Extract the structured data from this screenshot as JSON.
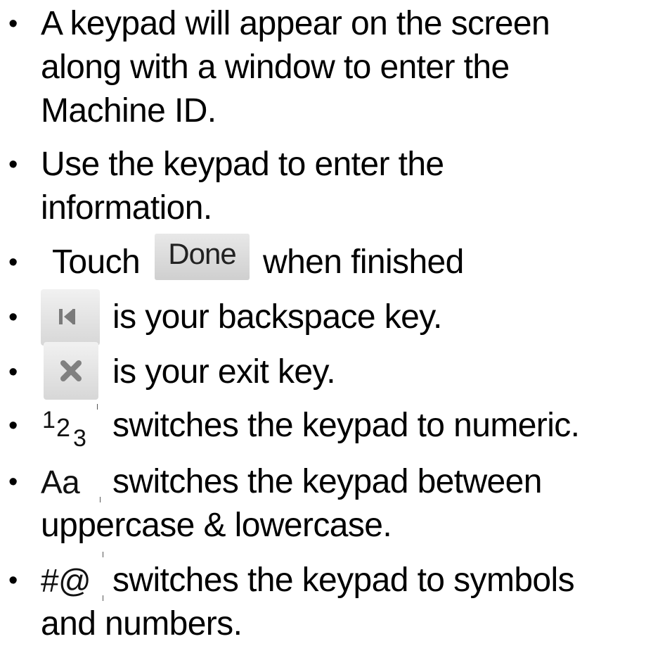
{
  "bullet_char": "•",
  "items": [
    {
      "lines": [
        "A keypad will appear on the screen",
        "along with a window to enter the",
        "Machine ID."
      ]
    },
    {
      "lines": [
        "Use the keypad to enter the",
        "information."
      ]
    },
    {
      "prefix": "Touch",
      "key_label": "Done",
      "suffix": "when finished"
    },
    {
      "key_icon": "backspace-key-icon",
      "suffix": "is your backspace key."
    },
    {
      "key_icon": "exit-key-icon",
      "suffix": "is your exit key."
    },
    {
      "key_label_parts": [
        "1",
        "2",
        "3"
      ],
      "suffix": "switches the keypad to numeric."
    },
    {
      "key_label": "Aa",
      "suffix": "switches the keypad between",
      "continuation": "uppercase & lowercase."
    },
    {
      "key_label": "#@",
      "suffix": "switches the keypad to symbols",
      "continuation": "and numbers."
    }
  ],
  "colors": {
    "text": "#000000",
    "key_background": "#d9d9d9",
    "key_icon": "#808080"
  }
}
